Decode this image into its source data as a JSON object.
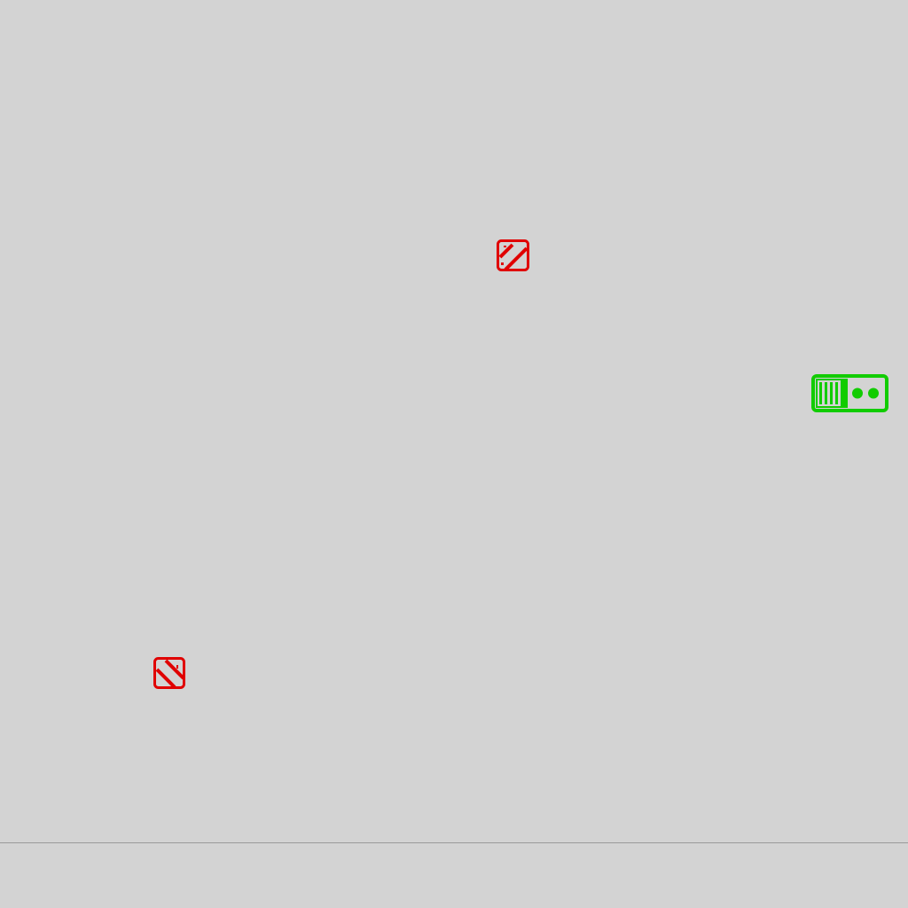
{
  "scene": {
    "background_color": "#d3d3d3",
    "ground_line_color": "#9a9a9a"
  },
  "entities": {
    "enemies": [
      {
        "type": "hazard-block",
        "color": "#e00000",
        "stripe_direction": "up-right"
      },
      {
        "type": "hazard-block",
        "color": "#e00000",
        "stripe_direction": "down-right"
      }
    ],
    "player": {
      "type": "tank",
      "color": "#11cc00"
    }
  }
}
